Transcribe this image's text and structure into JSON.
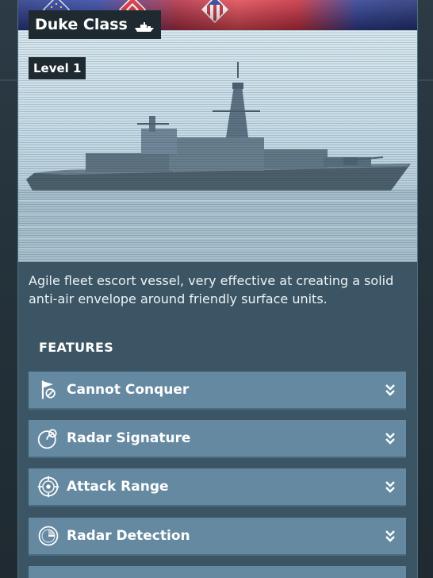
{
  "header": {
    "flags": [
      {
        "icon": "eu-flag-icon",
        "color": "#2b3f9a"
      },
      {
        "icon": "red-emblem-flag-icon",
        "color": "#d93040"
      },
      {
        "icon": "us-flag-icon",
        "color": "#c83040"
      }
    ]
  },
  "unit": {
    "name": "Duke Class",
    "type_icon": "ship-icon",
    "level": "Level 1",
    "description": "Agile fleet escort vessel, very effective at creating a solid anti-air envelope around friendly surface units."
  },
  "features": {
    "title": "FEATURES",
    "items": [
      {
        "label": "Cannot Conquer",
        "icon": "no-flag-icon"
      },
      {
        "label": "Radar Signature",
        "icon": "radar-signature-icon"
      },
      {
        "label": "Attack Range",
        "icon": "crosshair-icon"
      },
      {
        "label": "Radar Detection",
        "icon": "radar-detection-icon"
      }
    ],
    "expand_icon": "chevron-double-down-icon"
  },
  "colors": {
    "panel": "#3b5564",
    "feature_row": "#6489a0",
    "badge_bg": "#1f2a30"
  }
}
